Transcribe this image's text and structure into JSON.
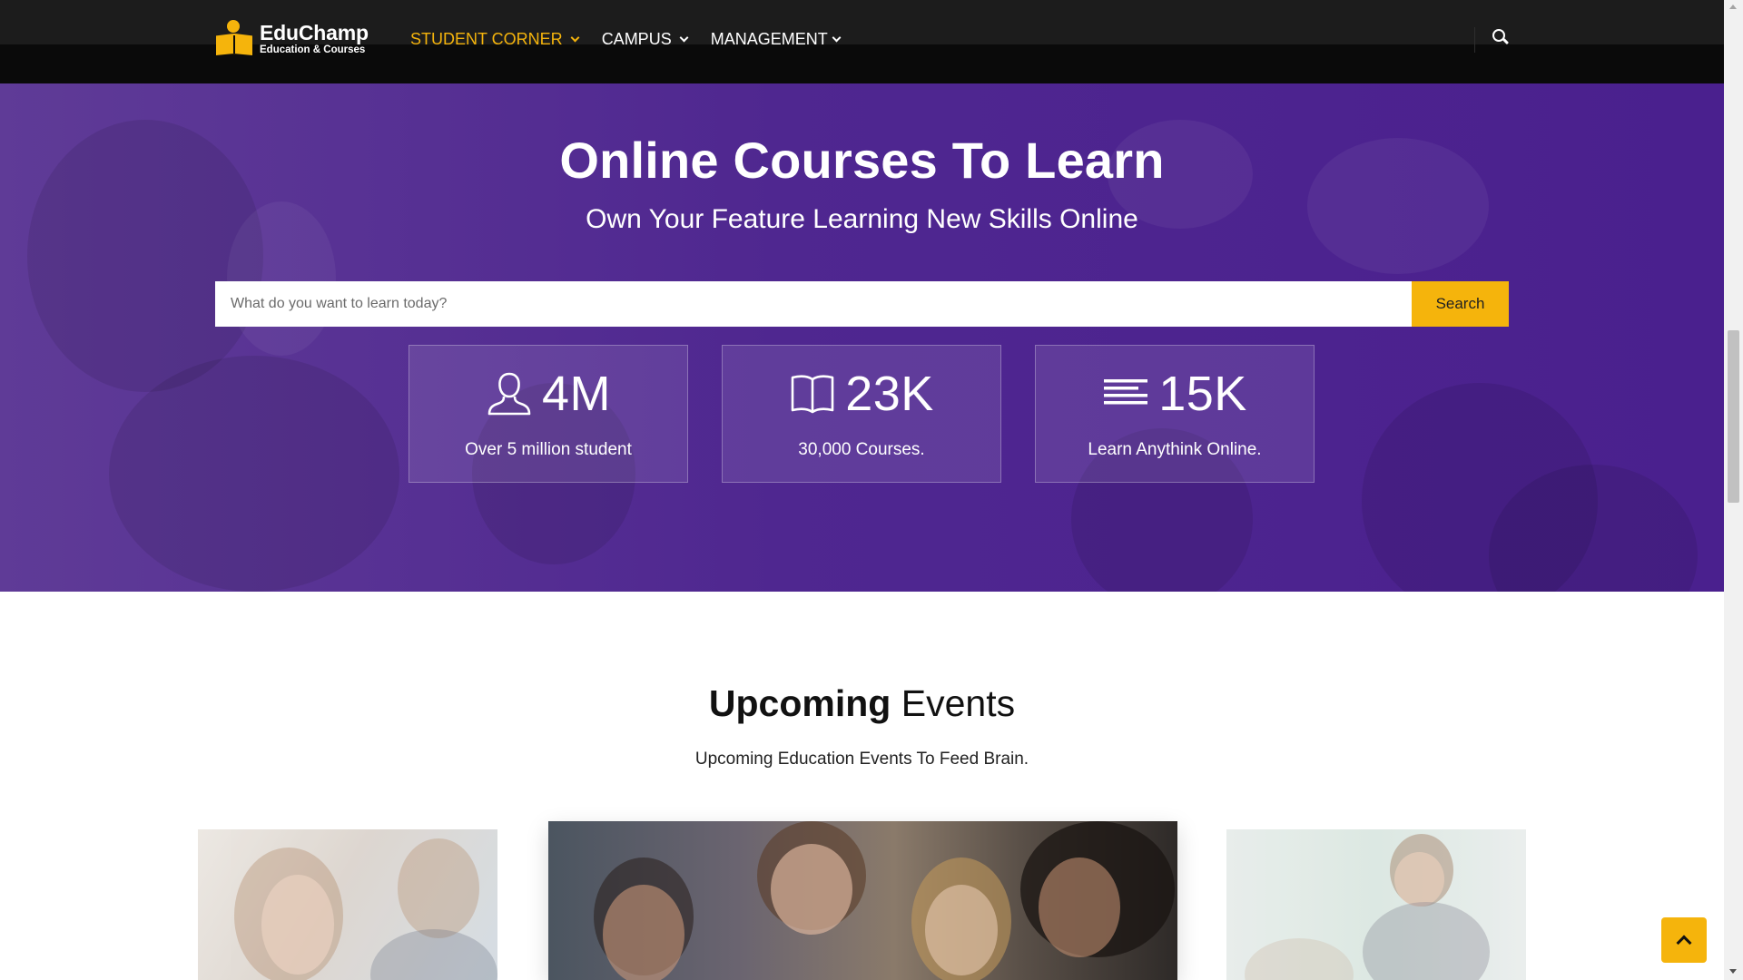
{
  "brand": {
    "name": "EduChamp",
    "tagline": "Education & Courses",
    "logo_icon": "reading-person-logo-icon"
  },
  "nav": {
    "items": [
      {
        "label": "STUDENT CORNER",
        "active": true
      },
      {
        "label": "CAMPUS",
        "active": false
      },
      {
        "label": "MANAGEMENT",
        "active": false
      }
    ],
    "search_icon": "search-icon"
  },
  "hero": {
    "title": "Online Courses To Learn",
    "subtitle": "Own Your Feature Learning New Skills Online",
    "search": {
      "placeholder": "What do you want to learn today?",
      "button_label": "Search"
    },
    "stats": [
      {
        "icon": "user-icon",
        "value": "4M",
        "label": "Over 5 million student"
      },
      {
        "icon": "book-icon",
        "value": "23K",
        "label": "30,000 Courses."
      },
      {
        "icon": "lines-icon",
        "value": "15K",
        "label": "Learn Anythink Online."
      }
    ]
  },
  "events": {
    "title_bold": "Upcoming",
    "title_light": "Events",
    "subtitle": "Upcoming Education Events To Feed Brain."
  },
  "colors": {
    "accent": "#f5b40c",
    "header_bg": "#0a0a0a",
    "hero_purple": "#4f2790"
  },
  "back_to_top_icon": "chevron-up-icon"
}
